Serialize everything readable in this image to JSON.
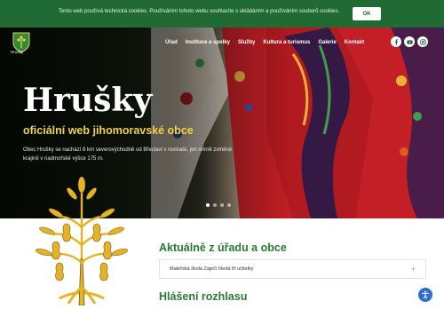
{
  "cookie": {
    "text": "Tento web používá technická cookies. Používáním tohoto webu souhlasíte s ukládáním a používáním souborů cookies.",
    "ok_label": "OK"
  },
  "header": {
    "logo_label": "Hrušky",
    "nav": [
      "Úřad",
      "Instituce a spolky",
      "Služby",
      "Kultura a turismus",
      "Galerie",
      "Kontakt"
    ],
    "social": [
      "facebook-icon",
      "youtube-icon",
      "instagram-icon"
    ]
  },
  "hero": {
    "title": "Hrušky",
    "subtitle": "oficiální web jihomoravské obce",
    "text": "Obec Hrušky se nachází 8 km severovýchodně od Břeclavi v rovinaté, jen mírně zvlněné krajině v nadmořské výšce 175 m.",
    "slides": 4,
    "active_slide": 1
  },
  "news": {
    "title": "Aktuálně z úřadu a obce",
    "items": [
      {
        "label": "Mateřská škola Zaječí hledá tři učitelky"
      }
    ]
  },
  "broadcast": {
    "title": "Hlášení rozhlasu"
  },
  "colors": {
    "brand_green": "#1f6b33",
    "section_green": "#2a7a33",
    "subtitle_yellow": "#f0d24a",
    "a11y_blue": "#2b6fd6"
  }
}
